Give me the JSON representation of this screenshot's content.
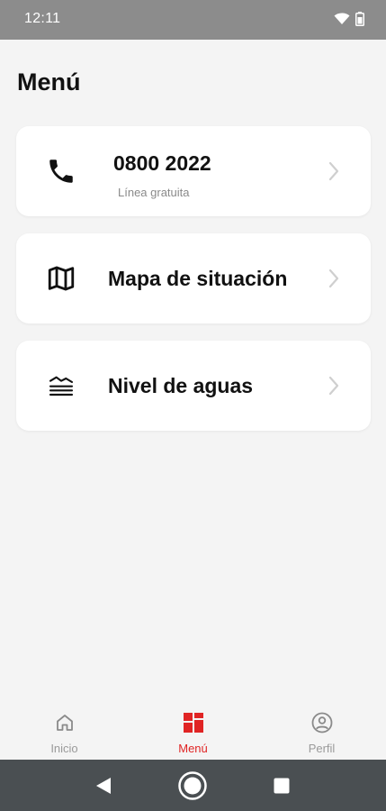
{
  "status_bar": {
    "time": "12:11"
  },
  "page": {
    "title": "Menú"
  },
  "cards": [
    {
      "icon": "phone-icon",
      "title": "0800 2022",
      "subtitle": "Línea gratuita"
    },
    {
      "icon": "map-icon",
      "title": "Mapa de situación"
    },
    {
      "icon": "water-level-icon",
      "title": "Nivel de aguas"
    }
  ],
  "bottom_nav": {
    "items": [
      {
        "label": "Inicio",
        "icon": "home-icon",
        "active": false
      },
      {
        "label": "Menú",
        "icon": "menu-grid-icon",
        "active": true
      },
      {
        "label": "Perfil",
        "icon": "profile-icon",
        "active": false
      }
    ]
  },
  "colors": {
    "accent": "#e02424",
    "background": "#f4f4f4",
    "status_bar": "#8c8c8c",
    "system_nav": "#4a4f52"
  }
}
